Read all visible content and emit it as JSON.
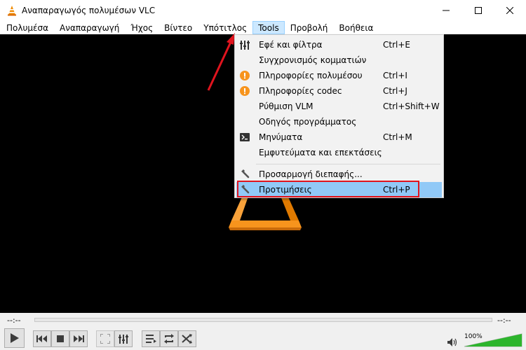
{
  "window": {
    "title": "Αναπαραγωγός πολυμέσων VLC",
    "controls": [
      "minimize-icon",
      "maximize-icon",
      "close-icon"
    ]
  },
  "menubar": {
    "items": [
      {
        "label": "Πολυμέσα"
      },
      {
        "label": "Αναπαραγωγή"
      },
      {
        "label": "Ήχος"
      },
      {
        "label": "Βίντεο"
      },
      {
        "label": "Υπότιτλος"
      },
      {
        "label": "Tools",
        "active": true
      },
      {
        "label": "Προβολή"
      },
      {
        "label": "Βοήθεια"
      }
    ]
  },
  "tools_menu": {
    "items": [
      {
        "label": "Εφέ και φίλτρα",
        "shortcut": "Ctrl+E",
        "icon": "equalizer-icon"
      },
      {
        "label": "Συγχρονισμός κομματιών",
        "shortcut": "",
        "icon": ""
      },
      {
        "label": "Πληροφορίες πολυμέσου",
        "shortcut": "Ctrl+I",
        "icon": "info-icon"
      },
      {
        "label": "Πληροφορίες codec",
        "shortcut": "Ctrl+J",
        "icon": "info-icon"
      },
      {
        "label": "Ρύθμιση VLM",
        "shortcut": "Ctrl+Shift+W",
        "icon": ""
      },
      {
        "label": "Οδηγός προγράμματος",
        "shortcut": "",
        "icon": ""
      },
      {
        "label": "Μηνύματα",
        "shortcut": "Ctrl+M",
        "icon": "terminal-icon"
      },
      {
        "label": "Εμφυτεύματα και επεκτάσεις",
        "shortcut": "",
        "icon": ""
      },
      {
        "label": "Προσαρμογή διεπαφής...",
        "shortcut": "",
        "icon": "wrench-icon"
      },
      {
        "label": "Προτιμήσεις",
        "shortcut": "Ctrl+P",
        "icon": "wrench-icon",
        "highlighted": true
      }
    ]
  },
  "player": {
    "elapsed": "--:--",
    "remaining": "--:--",
    "volume_label": "100%",
    "volume_level": 1.0
  },
  "colors": {
    "accent_highlight": "#91c9f7",
    "menu_active": "#cce8ff",
    "annotation_red": "#e0141e",
    "vlc_orange": "#f08a00",
    "volume_green": "#2db52d"
  }
}
